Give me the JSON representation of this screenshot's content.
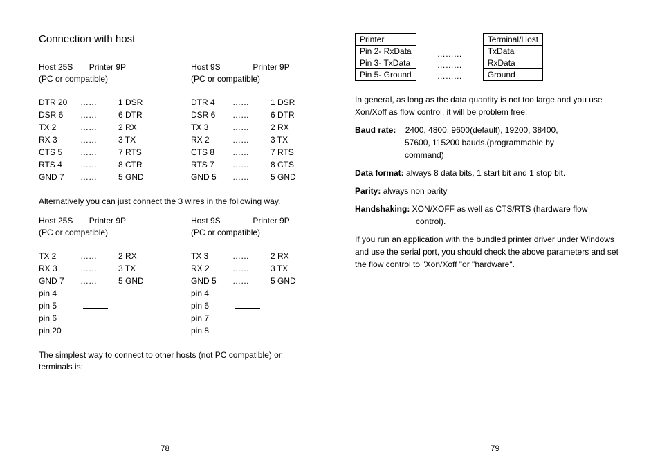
{
  "left": {
    "title": "Connection with host",
    "blockA": {
      "h1_host": "Host 25S",
      "h1_printer": "Printer 9P",
      "h1_sub": "(PC or compatible)",
      "rows": [
        {
          "l": "DTR 20",
          "d": "……",
          "r": "1 DSR"
        },
        {
          "l": "DSR 6",
          "d": "……",
          "r": "6 DTR"
        },
        {
          "l": "TX 2",
          "d": "……",
          "r": "2 RX"
        },
        {
          "l": "RX 3",
          "d": "……",
          "r": "3 TX"
        },
        {
          "l": "CTS 5",
          "d": "……",
          "r": "7 RTS"
        },
        {
          "l": "RTS 4",
          "d": "……",
          "r": "8 CTR"
        },
        {
          "l": "GND 7",
          "d": "……",
          "r": "5 GND"
        }
      ]
    },
    "blockB": {
      "h1_host": "Host 9S",
      "h1_printer": "Printer 9P",
      "h1_sub": "(PC or compatible)",
      "rows": [
        {
          "l": "DTR 4",
          "d": "……",
          "r": "1 DSR"
        },
        {
          "l": "DSR 6",
          "d": "……",
          "r": "6 DTR"
        },
        {
          "l": "TX 3",
          "d": "……",
          "r": "2 RX"
        },
        {
          "l": "RX 2",
          "d": "……",
          "r": "3 TX"
        },
        {
          "l": "CTS 8",
          "d": "……",
          "r": "7 RTS"
        },
        {
          "l": "RTS 7",
          "d": "……",
          "r": "8 CTS"
        },
        {
          "l": "GND 5",
          "d": "……",
          "r": "5 GND"
        }
      ]
    },
    "altText": "Alternatively you can just connect the 3 wires in the following way.",
    "blockC": {
      "h1_host": "Host 25S",
      "h1_printer": "Printer 9P",
      "h1_sub": "(PC or compatible)",
      "rows": [
        {
          "l": "TX 2",
          "d": "……",
          "r": "2 RX"
        },
        {
          "l": "RX 3",
          "d": "……",
          "r": "3 TX"
        },
        {
          "l": "GND 7",
          "d": "……",
          "r": "5 GND"
        }
      ],
      "underRows": [
        "pin 4",
        "pin 5",
        "pin 6",
        "pin 20"
      ]
    },
    "blockD": {
      "h1_host": "Host 9S",
      "h1_printer": "Printer 9P",
      "h1_sub": "(PC or compatible)",
      "rows": [
        {
          "l": "TX 3",
          "d": "……",
          "r": "2 RX"
        },
        {
          "l": "RX 2",
          "d": "……",
          "r": "3 TX"
        },
        {
          "l": "GND 5",
          "d": "……",
          "r": "5 GND"
        }
      ],
      "underRows": [
        "pin 4",
        "pin 6",
        "pin 7",
        "pin 8"
      ]
    },
    "simplest": "The simplest way to connect to other hosts (not PC compatible) or terminals is:",
    "pageNum": "78"
  },
  "right": {
    "table": {
      "left": [
        "Printer",
        "Pin 2- RxData",
        "Pin 3- TxData",
        "Pin 5- Ground"
      ],
      "dots": [
        "………",
        "………",
        "………"
      ],
      "right": [
        "Terminal/Host",
        "TxData",
        "RxData",
        "Ground"
      ]
    },
    "para1": "In general, as long as the data quantity is not too large and you use Xon/Xoff as flow control, it will be problem free.",
    "baud_label": "Baud rate:",
    "baud_val1": "2400, 4800, 9600(default), 19200, 38400,",
    "baud_val2": "57600, 115200 bauds.(programmable by",
    "baud_val3": "command)",
    "datafmt_label": "Data format:",
    "datafmt_val": " always 8 data bits, 1 start bit and 1 stop bit.",
    "parity_label": "Parity:",
    "parity_val": " always non parity",
    "hand_label": "Handshaking:",
    "hand_val1": " XON/XOFF as well as CTS/RTS (hardware flow",
    "hand_val2": "control).",
    "para2": "If you run an application with the bundled printer driver under Windows and use the serial port, you should check the above parameters and set the flow control to \"Xon/Xoff \"or \"hardware\".",
    "pageNum": "79"
  }
}
